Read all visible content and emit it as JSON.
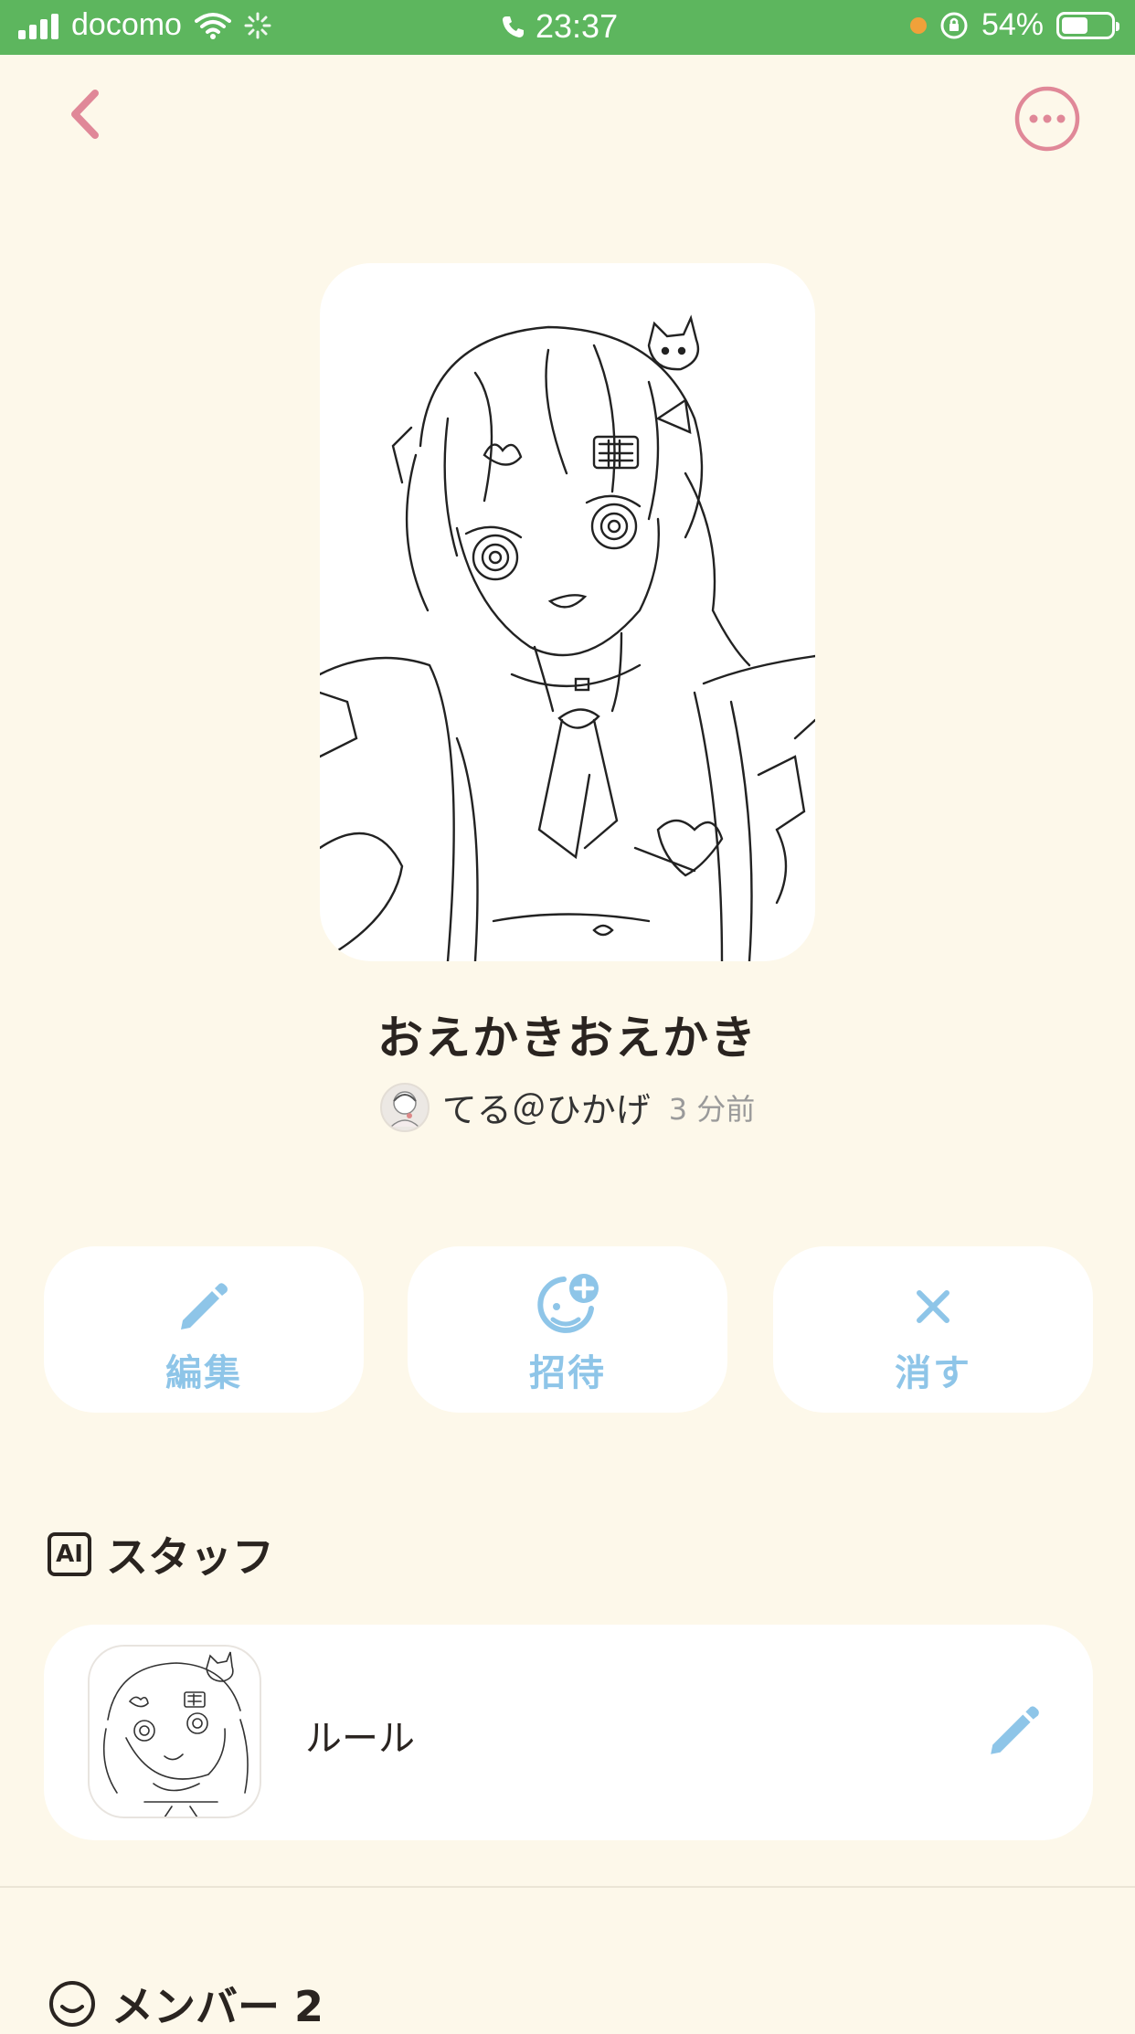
{
  "status_bar": {
    "carrier": "docomo",
    "time": "23:37",
    "battery": "54%",
    "battery_level": 0.54
  },
  "nav": {
    "back_icon": "chevron-left-icon",
    "more_icon": "more-icon"
  },
  "colors": {
    "background": "#fdf8ea",
    "status_bar": "#5db65e",
    "accent_pink": "#e08898",
    "action_blue": "#8ec5e8",
    "text": "#2a2420"
  },
  "room": {
    "title": "おえかきおえかき",
    "author": "てる＠ひかげ",
    "time_ago": "3 分前"
  },
  "actions": [
    {
      "label": "編集",
      "icon": "pencil-icon"
    },
    {
      "label": "招待",
      "icon": "invite-smile-plus-icon"
    },
    {
      "label": "消す",
      "icon": "close-icon"
    }
  ],
  "staff_section": {
    "title": "スタッフ",
    "icon_text": "AI",
    "items": [
      {
        "name": "ルール"
      }
    ]
  },
  "members_section": {
    "title": "メンバー 2"
  }
}
